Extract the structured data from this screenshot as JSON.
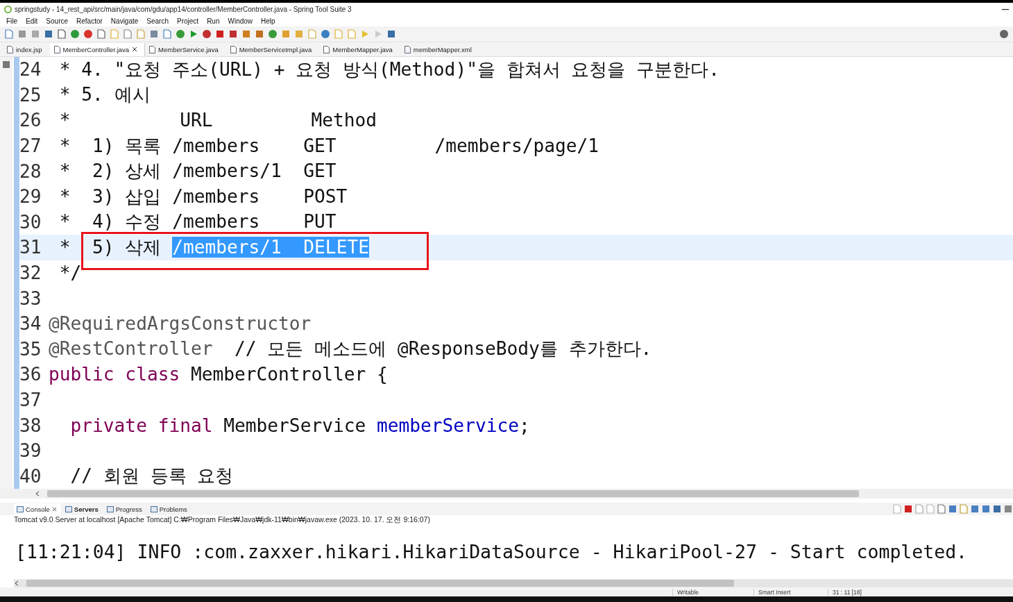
{
  "window": {
    "title": "springstudy - 14_rest_api/src/main/java/com/gdu/app14/controller/MemberController.java - Spring Tool Suite 3"
  },
  "menu": [
    "File",
    "Edit",
    "Source",
    "Refactor",
    "Navigate",
    "Search",
    "Project",
    "Run",
    "Window",
    "Help"
  ],
  "editor_tabs": [
    {
      "label": "index.jsp",
      "selected": false,
      "kind": "jsp"
    },
    {
      "label": "MemberController.java",
      "selected": true,
      "kind": "java"
    },
    {
      "label": "MemberService.java",
      "selected": false,
      "kind": "java"
    },
    {
      "label": "MemberServiceImpl.java",
      "selected": false,
      "kind": "java"
    },
    {
      "label": "MemberMapper.java",
      "selected": false,
      "kind": "java"
    },
    {
      "label": "memberMapper.xml",
      "selected": false,
      "kind": "xml"
    }
  ],
  "code_lines": [
    {
      "number": "24",
      "current": false,
      "annotated": false,
      "segments": [
        {
          "kind": "plain",
          "text": " * 4. \"요청 주소(URL) + 요청 방식(Method)\"을 합쳐서 요청을 구분한다."
        }
      ]
    },
    {
      "number": "25",
      "current": false,
      "annotated": false,
      "segments": [
        {
          "kind": "plain",
          "text": " * 5. 예시"
        }
      ]
    },
    {
      "number": "26",
      "current": false,
      "annotated": false,
      "segments": [
        {
          "kind": "plain",
          "text": " *          URL         Method"
        }
      ]
    },
    {
      "number": "27",
      "current": false,
      "annotated": false,
      "segments": [
        {
          "kind": "plain",
          "text": " *  1) 목록 /members    GET         /members/page/1"
        }
      ]
    },
    {
      "number": "28",
      "current": false,
      "annotated": false,
      "segments": [
        {
          "kind": "plain",
          "text": " *  2) 상세 /members/1  GET"
        }
      ]
    },
    {
      "number": "29",
      "current": false,
      "annotated": false,
      "segments": [
        {
          "kind": "plain",
          "text": " *  3) 삽입 /members    POST"
        }
      ]
    },
    {
      "number": "30",
      "current": false,
      "annotated": false,
      "segments": [
        {
          "kind": "plain",
          "text": " *  4) 수정 /members    PUT"
        }
      ]
    },
    {
      "number": "31",
      "current": true,
      "annotated": true,
      "segments": [
        {
          "kind": "plain",
          "text": " *  5) 삭제 "
        },
        {
          "kind": "selected",
          "text": "/members/1  DELETE"
        }
      ]
    },
    {
      "number": "32",
      "current": false,
      "annotated": false,
      "segments": [
        {
          "kind": "plain",
          "text": " */"
        }
      ]
    },
    {
      "number": "33",
      "current": false,
      "annotated": false
    },
    {
      "number": "34",
      "current": false,
      "annotated": false,
      "segments": [
        {
          "kind": "annotation",
          "text": "@RequiredArgsConstructor"
        }
      ]
    },
    {
      "number": "35",
      "current": false,
      "annotated": false,
      "segments": [
        {
          "kind": "annotation",
          "text": "@RestController"
        },
        {
          "kind": "plain",
          "text": "  // 모든 메소드에 @ResponseBody를 추가한다."
        }
      ]
    },
    {
      "number": "36",
      "current": false,
      "annotated": false,
      "segments": [
        {
          "kind": "keyword",
          "text": "public class"
        },
        {
          "kind": "plain",
          "text": " MemberController {"
        }
      ]
    },
    {
      "number": "37",
      "current": false,
      "annotated": false
    },
    {
      "number": "38",
      "current": false,
      "annotated": false,
      "segments": [
        {
          "kind": "keyword",
          "text": "  private final"
        },
        {
          "kind": "plain",
          "text": " MemberService "
        },
        {
          "kind": "field",
          "text": "memberService"
        },
        {
          "kind": "plain",
          "text": ";"
        }
      ]
    },
    {
      "number": "39",
      "current": false,
      "annotated": false
    },
    {
      "number": "40",
      "current": false,
      "annotated": false,
      "segments": [
        {
          "kind": "plain",
          "text": "  // 회원 등록 요청"
        }
      ]
    }
  ],
  "bottom_tabs": [
    {
      "label": "Console",
      "selected": true,
      "bold": false,
      "closable": true
    },
    {
      "label": "Servers",
      "selected": false,
      "bold": true,
      "closable": false
    },
    {
      "label": "Progress",
      "selected": false,
      "bold": false,
      "closable": false
    },
    {
      "label": "Problems",
      "selected": false,
      "bold": false,
      "closable": false
    }
  ],
  "console": {
    "process": "Tomcat v9.0 Server at localhost [Apache Tomcat] C:₩Program Files₩Java₩jdk-11₩bin₩javaw.exe  (2023. 10. 17. 오전 9:16:07)",
    "lines": [
      "[11:21:04] INFO :com.zaxxer.hikari.HikariDataSource - HikariPool-27 - Start completed."
    ]
  },
  "status_bar": [
    "Writable",
    "Smart Insert",
    "31 : 11 [18]"
  ]
}
